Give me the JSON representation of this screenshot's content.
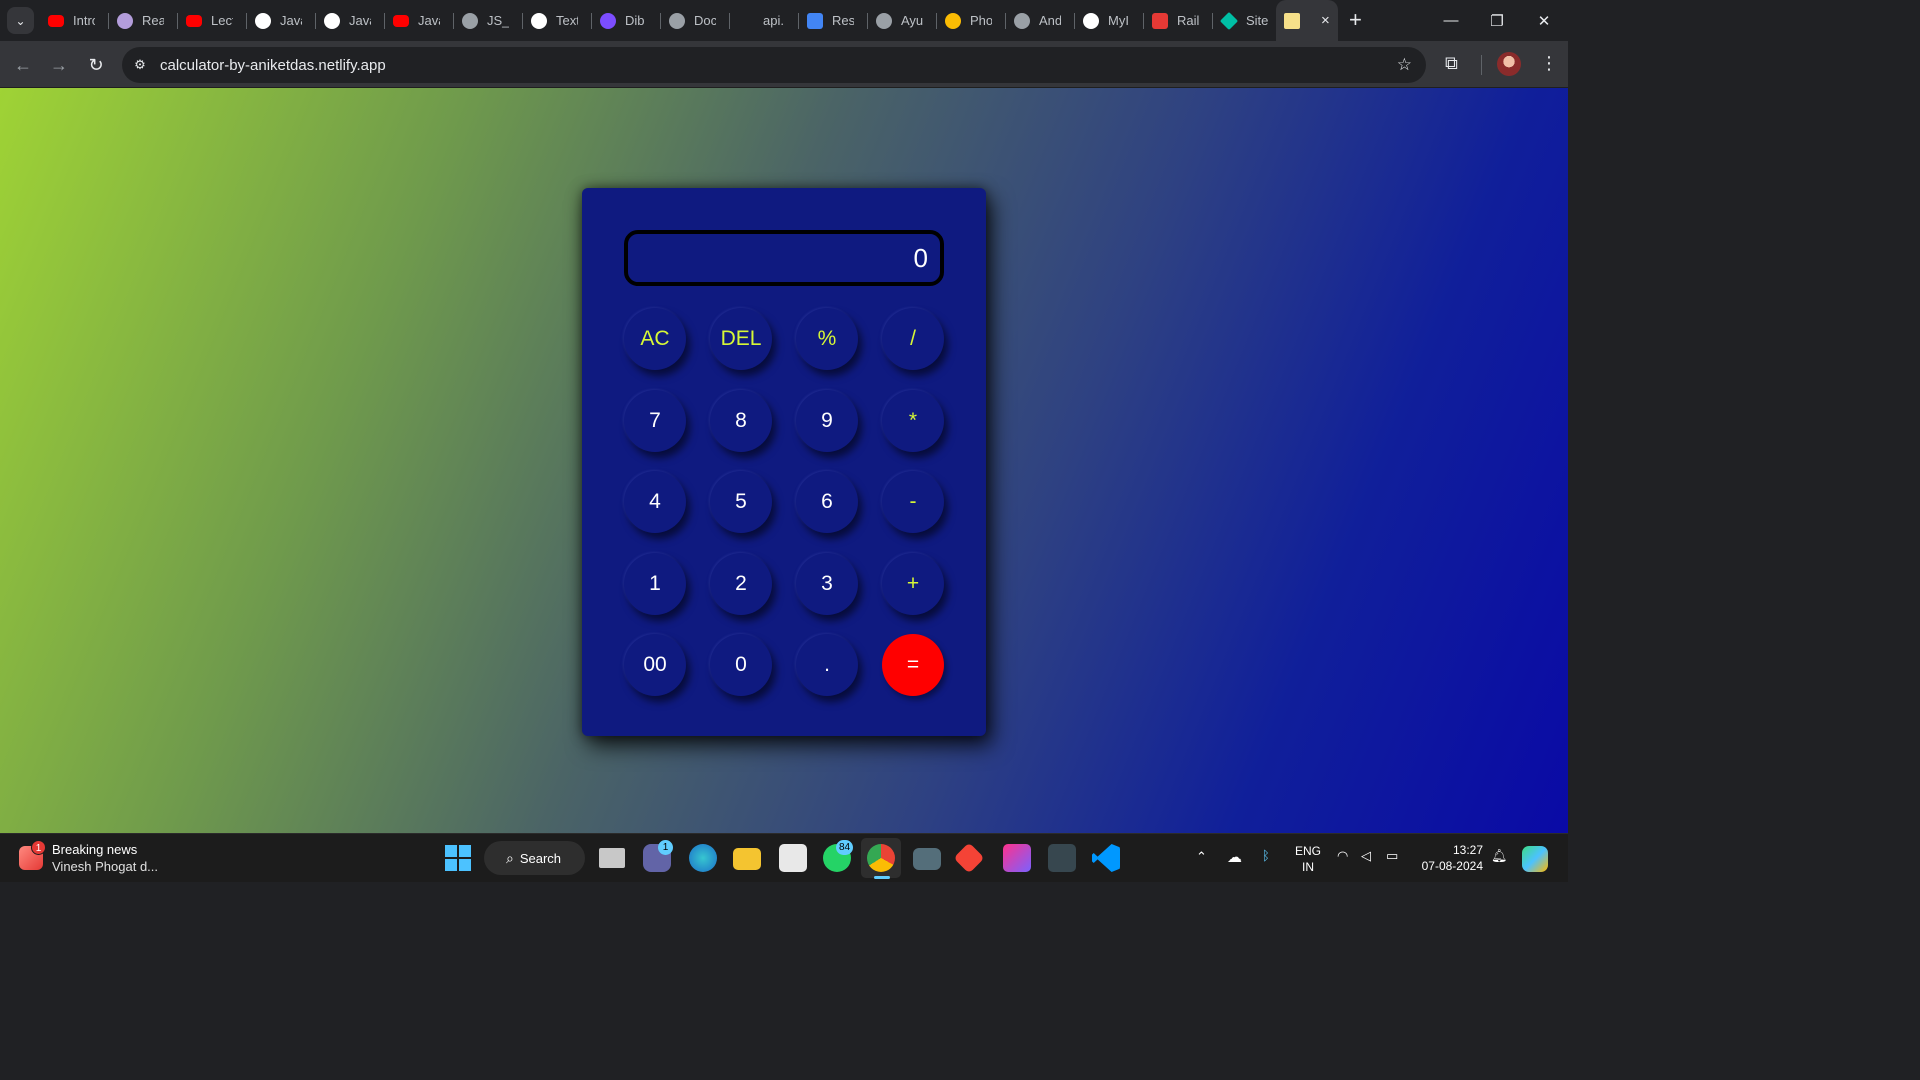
{
  "browser": {
    "tabs": [
      {
        "label": "Intro",
        "icon": "youtube-icon",
        "color": "#ff0000"
      },
      {
        "label": "Rea",
        "icon": "avatar-icon",
        "color": "#b39ddb"
      },
      {
        "label": "Lect",
        "icon": "youtube-icon",
        "color": "#ff0000"
      },
      {
        "label": "Java",
        "icon": "github-icon",
        "color": "#ffffff"
      },
      {
        "label": "Java",
        "icon": "github-icon",
        "color": "#ffffff"
      },
      {
        "label": "Java",
        "icon": "youtube-icon",
        "color": "#ff0000"
      },
      {
        "label": "JS_C",
        "icon": "globe-icon",
        "color": "#9aa0a6"
      },
      {
        "label": "Text",
        "icon": "github-icon",
        "color": "#ffffff"
      },
      {
        "label": "Dib",
        "icon": "dib-icon",
        "color": "#7c4dff"
      },
      {
        "label": "Doc",
        "icon": "globe-icon",
        "color": "#9aa0a6"
      },
      {
        "label": "api.",
        "icon": "none",
        "color": "#202124"
      },
      {
        "label": "Res",
        "icon": "docs-icon",
        "color": "#4285f4"
      },
      {
        "label": "Ayu",
        "icon": "globe-icon",
        "color": "#9aa0a6"
      },
      {
        "label": "Pho",
        "icon": "photos-icon",
        "color": "#fbbc04"
      },
      {
        "label": "And",
        "icon": "globe-icon",
        "color": "#9aa0a6"
      },
      {
        "label": "MyI",
        "icon": "github-icon",
        "color": "#ffffff"
      },
      {
        "label": "Rail",
        "icon": "rail-icon",
        "color": "#e53935"
      },
      {
        "label": "Site",
        "icon": "diamond-icon",
        "color": "#00bfa5"
      }
    ],
    "active_tab": {
      "icon": "notes-icon",
      "close": "×"
    },
    "new_tab": "+",
    "window_controls": {
      "minimize": "—",
      "restore": "❐",
      "close": "✕"
    },
    "url": "calculator-by-aniketdas.netlify.app"
  },
  "calculator": {
    "display": "0",
    "keys": [
      {
        "label": "AC",
        "type": "op"
      },
      {
        "label": "DEL",
        "type": "op"
      },
      {
        "label": "%",
        "type": "op"
      },
      {
        "label": "/",
        "type": "op"
      },
      {
        "label": "7",
        "type": "num"
      },
      {
        "label": "8",
        "type": "num"
      },
      {
        "label": "9",
        "type": "num"
      },
      {
        "label": "*",
        "type": "op"
      },
      {
        "label": "4",
        "type": "num"
      },
      {
        "label": "5",
        "type": "num"
      },
      {
        "label": "6",
        "type": "num"
      },
      {
        "label": "-",
        "type": "op"
      },
      {
        "label": "1",
        "type": "num"
      },
      {
        "label": "2",
        "type": "num"
      },
      {
        "label": "3",
        "type": "num"
      },
      {
        "label": "+",
        "type": "op"
      },
      {
        "label": "00",
        "type": "num"
      },
      {
        "label": "0",
        "type": "num"
      },
      {
        "label": ".",
        "type": "num"
      },
      {
        "label": "=",
        "type": "equals"
      }
    ]
  },
  "taskbar": {
    "news_badge": "1",
    "news_title": "Breaking news",
    "news_sub": "Vinesh Phogat d...",
    "search_label": "Search",
    "teams_badge": "1",
    "whatsapp_badge": "84",
    "lang_top": "ENG",
    "lang_bottom": "IN",
    "time": "13:27",
    "date": "07-08-2024"
  }
}
